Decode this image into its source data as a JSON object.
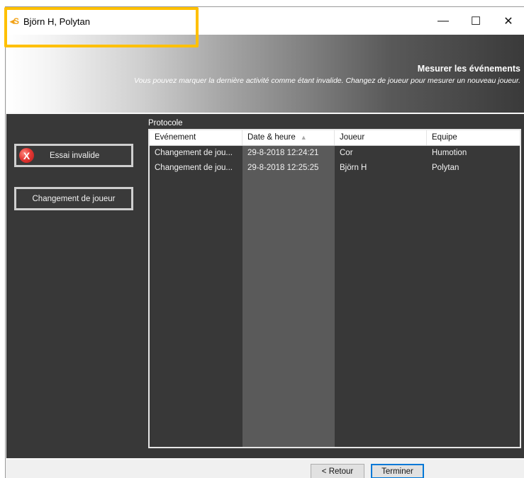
{
  "window": {
    "logo": "◂S",
    "title": "Björn H, Polytan",
    "controls": {
      "minimize": "—",
      "maximize": "☐",
      "close": "✕"
    }
  },
  "header": {
    "title": "Mesurer les événements",
    "subtitle": "Vous pouvez marquer la dernière activité comme étant invalide. Changez de joueur pour mesurer un nouveau joueur."
  },
  "sidebar": {
    "invalid_icon": "X",
    "invalid_label": "Essai invalide",
    "change_label": "Changement de joueur"
  },
  "protocol": {
    "label": "Protocole",
    "columns": [
      "Evénement",
      "Date & heure",
      "Joueur",
      "Equipe"
    ],
    "sort_indicator": "▲",
    "rows": [
      [
        "Changement de jou...",
        "29-8-2018 12:24:21",
        "Cor",
        "Humotion"
      ],
      [
        "Changement de jou...",
        "29-8-2018 12:25:25",
        "Björn H",
        "Polytan"
      ]
    ]
  },
  "footer": {
    "back_label": "< Retour",
    "finish_label": "Terminer"
  },
  "colors": {
    "highlight": "#ffc000",
    "panel_bg": "#383838",
    "sorted_column": "#5a5a5a",
    "default_button_border": "#0078d7"
  }
}
